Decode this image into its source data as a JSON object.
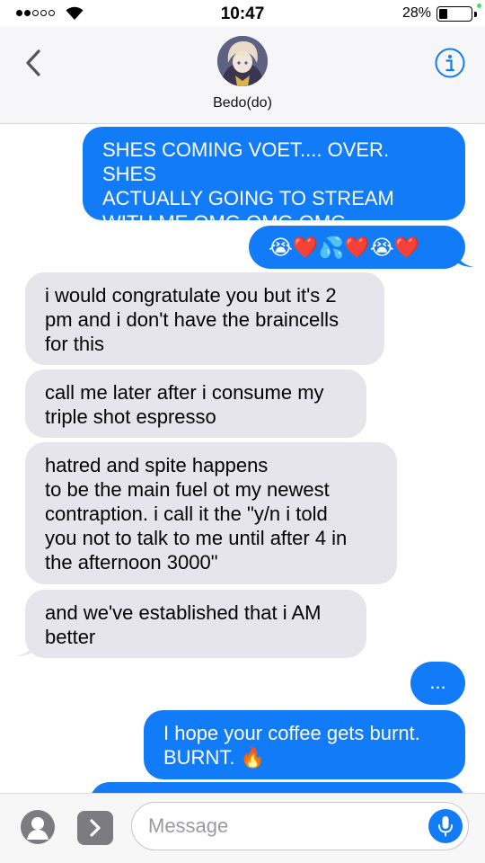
{
  "status_bar": {
    "time": "10:47",
    "battery_percent": "28%",
    "battery_level": 0.28,
    "signal_bars_filled": 2,
    "signal_bars_total": 5
  },
  "header": {
    "contact_name": "Bedo(do)",
    "back_icon": "chevron-left-icon",
    "info_icon": "info-icon"
  },
  "messages": [
    {
      "direction": "sent",
      "text": "SHES COMING VOET.... OVER. SHES\nACTUALLY GOING TO STREAM\nWITH ME OMG OMG OMG"
    },
    {
      "direction": "sent",
      "text": "😭❤️💦❤️😭❤️"
    },
    {
      "direction": "received",
      "text": "i would congratulate you but it's 2\npm and i don't have the braincells\nfor this"
    },
    {
      "direction": "received",
      "text": "call me later after i consume my\ntriple shot espresso"
    },
    {
      "direction": "received",
      "text": "hatred and spite happens\nto be the main fuel ot my newest\ncontraption. i call it the \"y/n i told\nyou not to talk to me until after 4 in\nthe afternoon 3000\""
    },
    {
      "direction": "received",
      "text": "and we've established that i AM\nbetter"
    },
    {
      "direction": "sent",
      "text": "..."
    },
    {
      "direction": "sent",
      "text": "I hope your coffee gets burnt.\nBURNT. 🔥"
    }
  ],
  "composer": {
    "placeholder": "Message",
    "value": "",
    "camera_icon": "camera-icon",
    "apps_icon": "chevron-right-icon",
    "mic_icon": "microphone-icon"
  },
  "colors": {
    "sent_bubble": "#127cf8",
    "received_bubble": "#e6e5eb",
    "accent": "#127cf8"
  }
}
